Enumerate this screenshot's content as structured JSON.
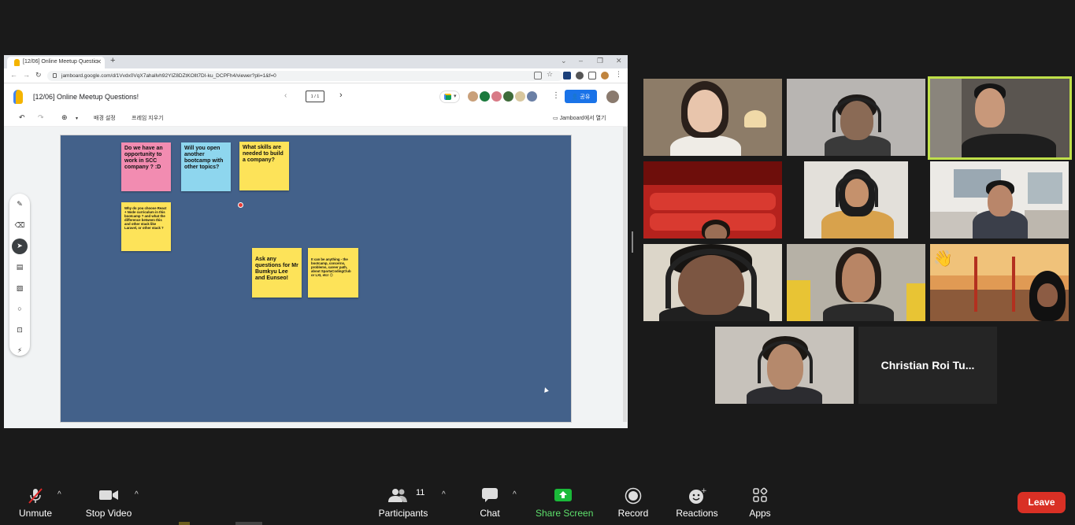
{
  "browser": {
    "tab_title": "[12/06] Online Meetup Questio",
    "url": "jamboard.google.com/d/1Vvdx0VqX7ahallvh92YIZ8DZtKOllt7DI-ku_DCPFh4/viewer?pli=1&f=0"
  },
  "jamboard": {
    "title": "[12/06] Online Meetup Questions!",
    "frame_indicator": "1 / 1",
    "share_label": "공유",
    "toolbar": {
      "background_label": "배경 설정",
      "clear_frame_label": "프레임 지우기",
      "open_in_jamboard_label": "Jamboard에서 열기"
    },
    "notes": [
      {
        "text": "Do we have an opportunity to work in SCC company ? :D",
        "color": "pink",
        "size": "big"
      },
      {
        "text": "Will you open another bootcamp with other topics?",
        "color": "blue",
        "size": "big"
      },
      {
        "text": "What skills are needed to build a company?",
        "color": "yellow",
        "size": "big"
      },
      {
        "text": "Why do you choose React + Node curriculum in this bootcamp ? and what the difference between this and other stack like Laravel, or other stack ?",
        "color": "yellow",
        "size": "small"
      },
      {
        "text": "Ask any questions for Mr Bumkyu Lee and Eunseo!",
        "color": "yellow",
        "size": "big"
      },
      {
        "text": "It can be anything - the bootcamp, concerns, problems, career path, about SpartaCodingClub or LXI, etc! 😊",
        "color": "yellow",
        "size": "small"
      }
    ]
  },
  "gallery": {
    "name_tile": "Christian Roi Tu...",
    "reaction_emoji": "👋"
  },
  "controls": {
    "unmute": "Unmute",
    "stop_video": "Stop Video",
    "participants": "Participants",
    "participants_count": "11",
    "chat": "Chat",
    "share_screen": "Share Screen",
    "record": "Record",
    "reactions": "Reactions",
    "apps": "Apps",
    "leave": "Leave"
  },
  "colors": {
    "share_screen_green": "#1aba39",
    "leave_red": "#d93025",
    "active_speaker_border": "#bfe049",
    "board_background": "#43618a",
    "share_button_blue": "#1a73e8"
  }
}
